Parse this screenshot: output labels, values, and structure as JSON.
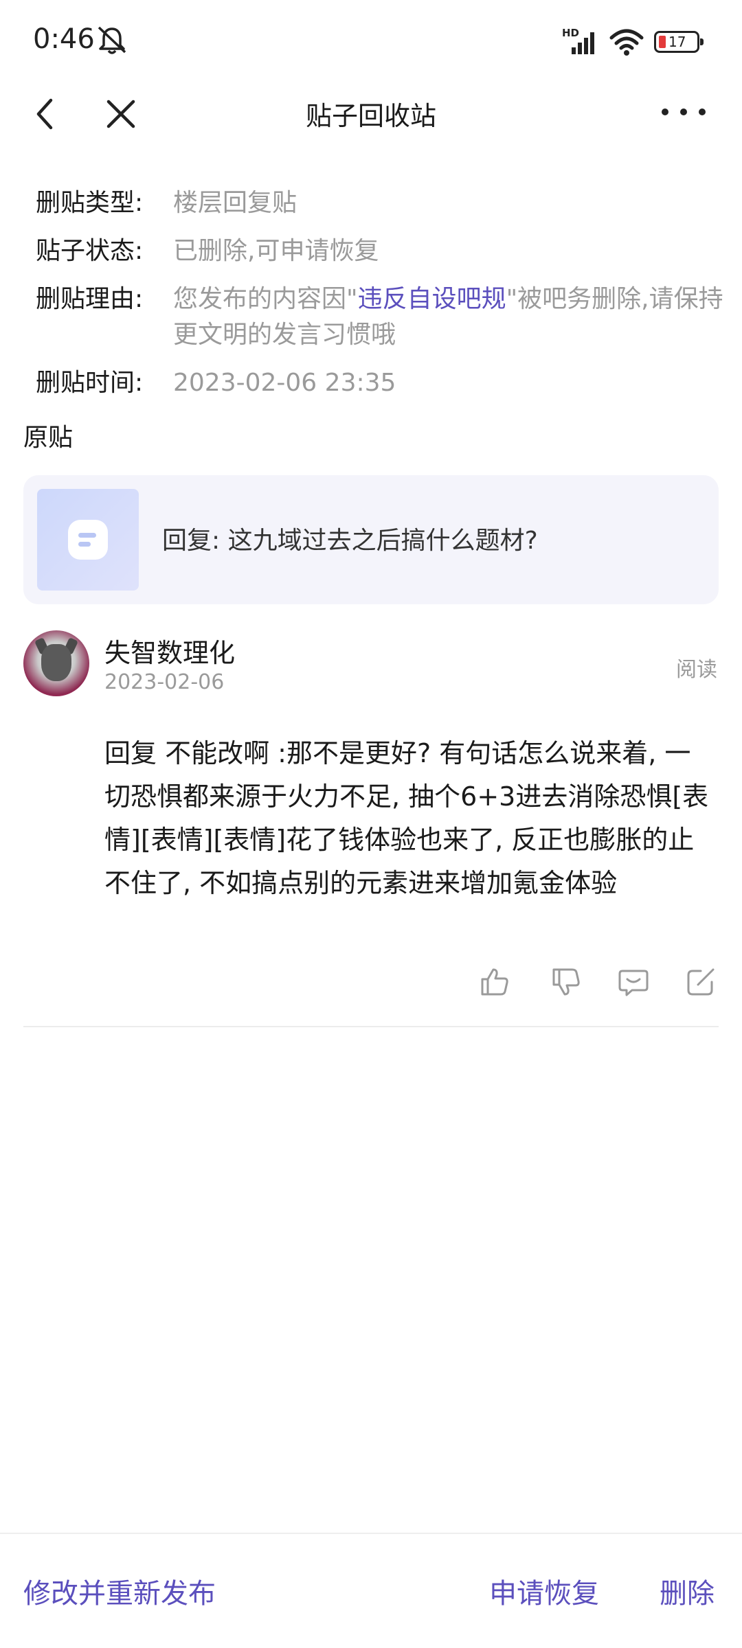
{
  "status_bar": {
    "time": "0:46",
    "hd_label": "HD",
    "battery_level": "17",
    "battery_color": "#e33b3b"
  },
  "nav": {
    "title": "贴子回收站",
    "back_icon": "chevron-left-icon",
    "close_icon": "close-icon",
    "more_icon": "more-horizontal-icon"
  },
  "info": {
    "type_label": "删贴类型:",
    "type_value": "楼层回复贴",
    "status_label": "贴子状态:",
    "status_value": "已删除,可申请恢复",
    "reason_label": "删贴理由:",
    "reason_prefix": "您发布的内容因\"",
    "reason_highlight": "违反自设吧规",
    "reason_suffix": "\"被吧务删除,请保持更文明的发言习惯哦",
    "time_label": "删贴时间:",
    "time_value": "2023-02-06 23:35"
  },
  "original": {
    "section_title": "原贴",
    "card_text": "回复: 这九域过去之后搞什么题材?"
  },
  "author": {
    "name": "失智数理化",
    "date": "2023-02-06",
    "read_label": "阅读"
  },
  "reply": {
    "content": " 回复  不能改啊 :那不是更好? 有句话怎么说来着, 一切恐惧都来源于火力不足, 抽个6+3进去消除恐惧[表情][表情][表情]花了钱体验也来了, 反正也膨胀的止不住了, 不如搞点别的元素进来增加氪金体验"
  },
  "actions": {
    "icons": [
      "thumbs-up-icon",
      "thumbs-down-icon",
      "comment-icon",
      "edit-icon"
    ]
  },
  "bottom_bar": {
    "republish_label": "修改并重新发布",
    "restore_label": "申请恢复",
    "delete_label": "删除",
    "accent_color": "#5b4fbd"
  }
}
